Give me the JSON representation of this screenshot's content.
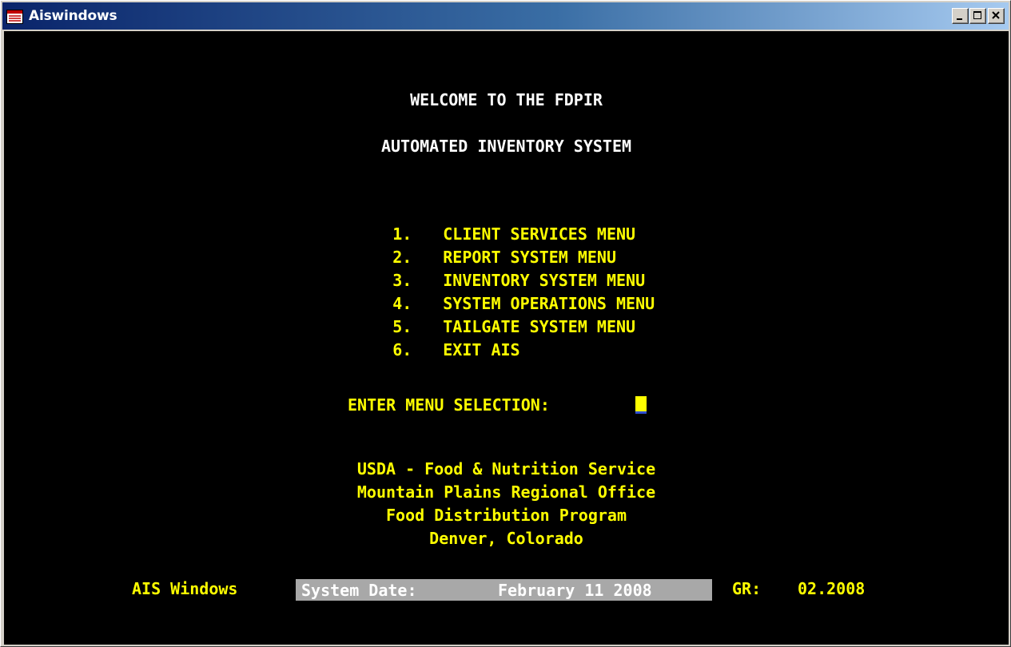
{
  "window": {
    "title": "Aiswindows",
    "icon": "app-window-icon",
    "controls": [
      "minimize-icon",
      "maximize-icon",
      "close-icon"
    ]
  },
  "console": {
    "welcome_line_1": "WELCOME TO THE FDPIR",
    "welcome_line_2": "AUTOMATED INVENTORY SYSTEM",
    "menu_items": [
      {
        "number": "1.",
        "label": "CLIENT SERVICES MENU"
      },
      {
        "number": "2.",
        "label": "REPORT SYSTEM MENU"
      },
      {
        "number": "3.",
        "label": "INVENTORY SYSTEM MENU"
      },
      {
        "number": "4.",
        "label": "SYSTEM OPERATIONS MENU"
      },
      {
        "number": "5.",
        "label": "TAILGATE SYSTEM MENU"
      },
      {
        "number": "6.",
        "label": "EXIT AIS"
      }
    ],
    "prompt": "ENTER MENU SELECTION:",
    "selection_value": "",
    "footer_lines": [
      "USDA - Food & Nutrition Service",
      "Mountain Plains Regional Office",
      "Food Distribution Program",
      "Denver, Colorado"
    ]
  },
  "status_bar": {
    "app_label": "AIS Windows",
    "date_label": "System Date:",
    "date_value": "February 11 2008",
    "gr_label": "GR:",
    "gr_value": "02.2008"
  },
  "colors": {
    "background": "#000000",
    "text_primary": "#ffff00",
    "text_header": "#ffffff",
    "date_box": "#a8a8a8",
    "titlebar_start": "#0a246a",
    "titlebar_end": "#a6caf0"
  }
}
